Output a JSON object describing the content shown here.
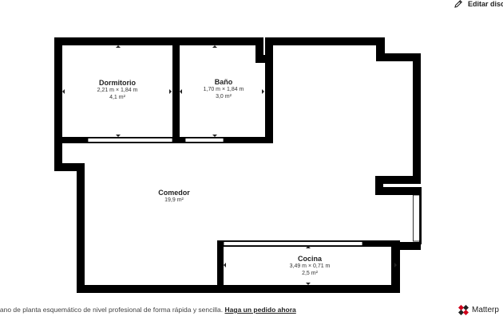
{
  "header": {
    "edit_label": "Editar disc",
    "edit_icon": "pencil-icon"
  },
  "rooms": [
    {
      "name": "Dormitorio",
      "dims": "2,21 m × 1,84 m",
      "area": "4,1 m²"
    },
    {
      "name": "Baño",
      "dims": "1,70 m × 1,84 m",
      "area": "3,0 m²"
    },
    {
      "name": "Comedor",
      "dims": "",
      "area": "19,9 m²"
    },
    {
      "name": "Cocina",
      "dims": "3,49 m × 0,71 m",
      "area": "2,5 m²"
    }
  ],
  "footer": {
    "text": "lano de planta esquemático de nivel profesional de forma rápida y sencilla.",
    "link": "Haga un pedido ahora"
  },
  "brand": {
    "name": "Matterp",
    "icon": "matterport-logo-icon",
    "colors": [
      "#d0021b",
      "#222222"
    ]
  },
  "colors": {
    "wall": "#000000",
    "floor": "#ffffff",
    "text": "#222222"
  }
}
